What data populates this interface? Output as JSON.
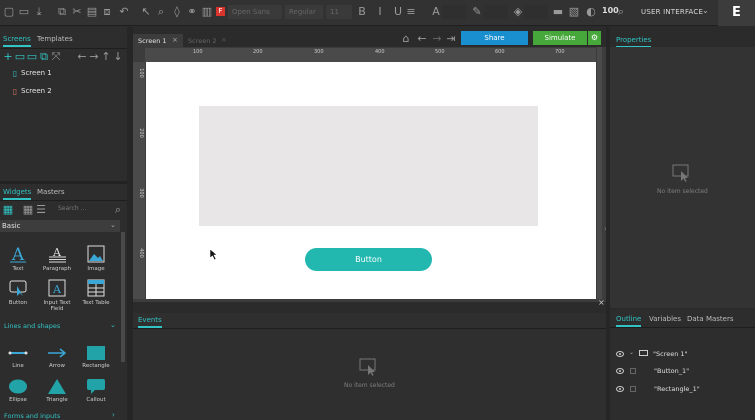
{
  "toolbar": {
    "font_family": "Open Sans",
    "font_weight": "Regular",
    "font_size": "11",
    "zoom": "100",
    "mode": "USER INTERFACE",
    "logo": "E"
  },
  "left_panel": {
    "tabs": [
      "Screens",
      "Templates"
    ],
    "screens": [
      "Screen 1",
      "Screen 2"
    ],
    "widget_tabs": [
      "Widgets",
      "Masters"
    ],
    "search_placeholder": "Search ...",
    "library": "Basic",
    "widgets": [
      "Text",
      "Paragraph",
      "Image",
      "Button",
      "Input Text Field",
      "Text Table"
    ],
    "section_lines": "Lines and shapes",
    "shapes": [
      "Line",
      "Arrow",
      "Rectangle",
      "Ellipse",
      "Triangle",
      "Callout"
    ],
    "section_forms": "Forms and inputs"
  },
  "editor": {
    "tabs": [
      "Screen 1",
      "Screen 2"
    ],
    "share_label": "Share",
    "simulate_label": "Simulate",
    "ruler_top": [
      "100",
      "200",
      "300",
      "400",
      "500",
      "600",
      "700"
    ],
    "ruler_left": [
      "100",
      "200",
      "300",
      "400"
    ],
    "button_label": "Button"
  },
  "events": {
    "tab": "Events",
    "empty": "No item selected"
  },
  "properties": {
    "tab": "Properties",
    "empty": "No item selected"
  },
  "outline": {
    "tabs": [
      "Outline",
      "Variables",
      "Data Masters"
    ],
    "items": [
      "\"Screen 1\"",
      "\"Button_1\"",
      "\"Rectangle_1\""
    ]
  },
  "colors": {
    "accent": "#32c4c4",
    "share": "#1a8fd0",
    "simulate": "#46a83a",
    "button": "#22b8b0"
  }
}
